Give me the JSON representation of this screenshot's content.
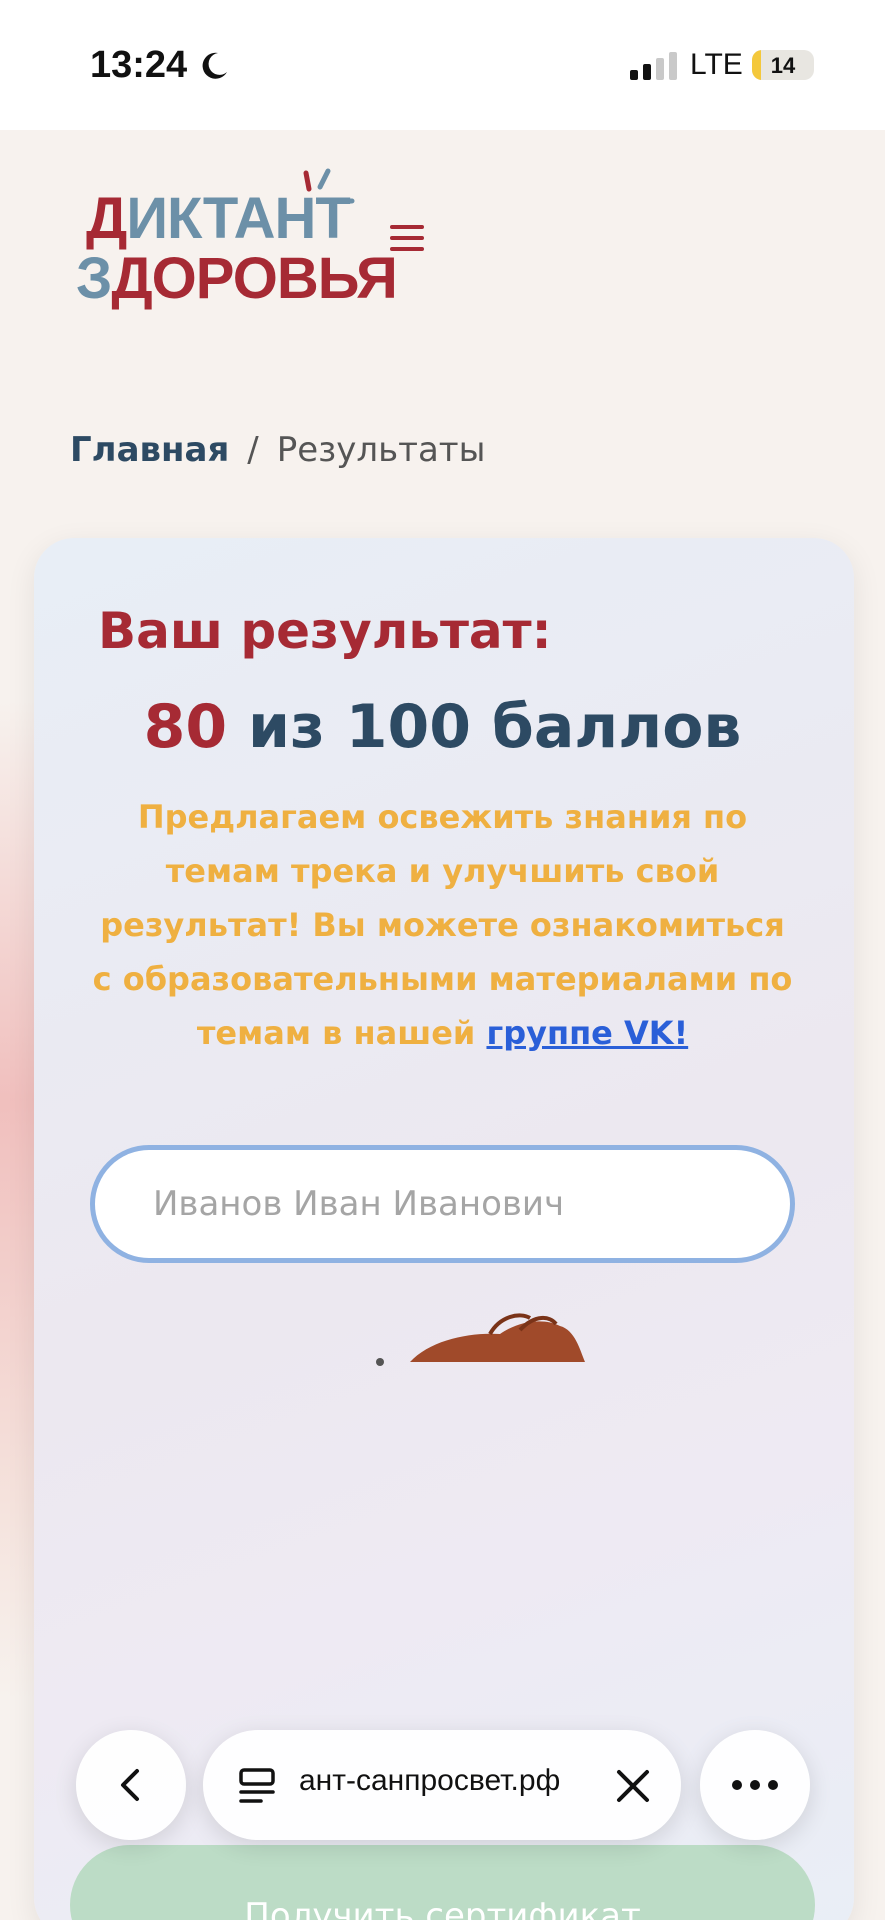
{
  "status_bar": {
    "time": "13:24",
    "network": "LTE",
    "battery": "14",
    "icons": [
      "moon-icon",
      "signal-icon",
      "battery-icon"
    ]
  },
  "header": {
    "logo_line1_first": "Д",
    "logo_line1_rest": "ИКТАНТ",
    "logo_line2_first": "З",
    "logo_line2_rest": "ДОРОВЬЯ",
    "menu_icon": "hamburger-icon"
  },
  "breadcrumb": {
    "home": "Главная",
    "separator": "/",
    "current": "Результаты"
  },
  "result": {
    "title": "Ваш результат:",
    "score_value": "80",
    "score_rest": " из 100 баллов",
    "promo_text": "Предлагаем освежить знания по темам трека и улучшить свой результат! Вы можете ознакомиться с образовательными материалами по темам в нашей ",
    "promo_link": "группе VK!"
  },
  "name_field": {
    "placeholder": "Иванов Иван Иванович",
    "value": ""
  },
  "certificate_button": "Получить сертификат",
  "browser": {
    "url": "диктант-санпросвет.рф",
    "url_visible": "ант-санпросвет.рф",
    "icons": [
      "back-icon",
      "tabs-icon",
      "close-icon",
      "more-icon"
    ]
  },
  "colors": {
    "brand_red": "#a62a34",
    "brand_blue": "#2d4a63",
    "promo_orange": "#efb041",
    "link_blue": "#2a5fd8",
    "input_border": "#8fb2e2",
    "button_green": "#bcdcc6"
  }
}
